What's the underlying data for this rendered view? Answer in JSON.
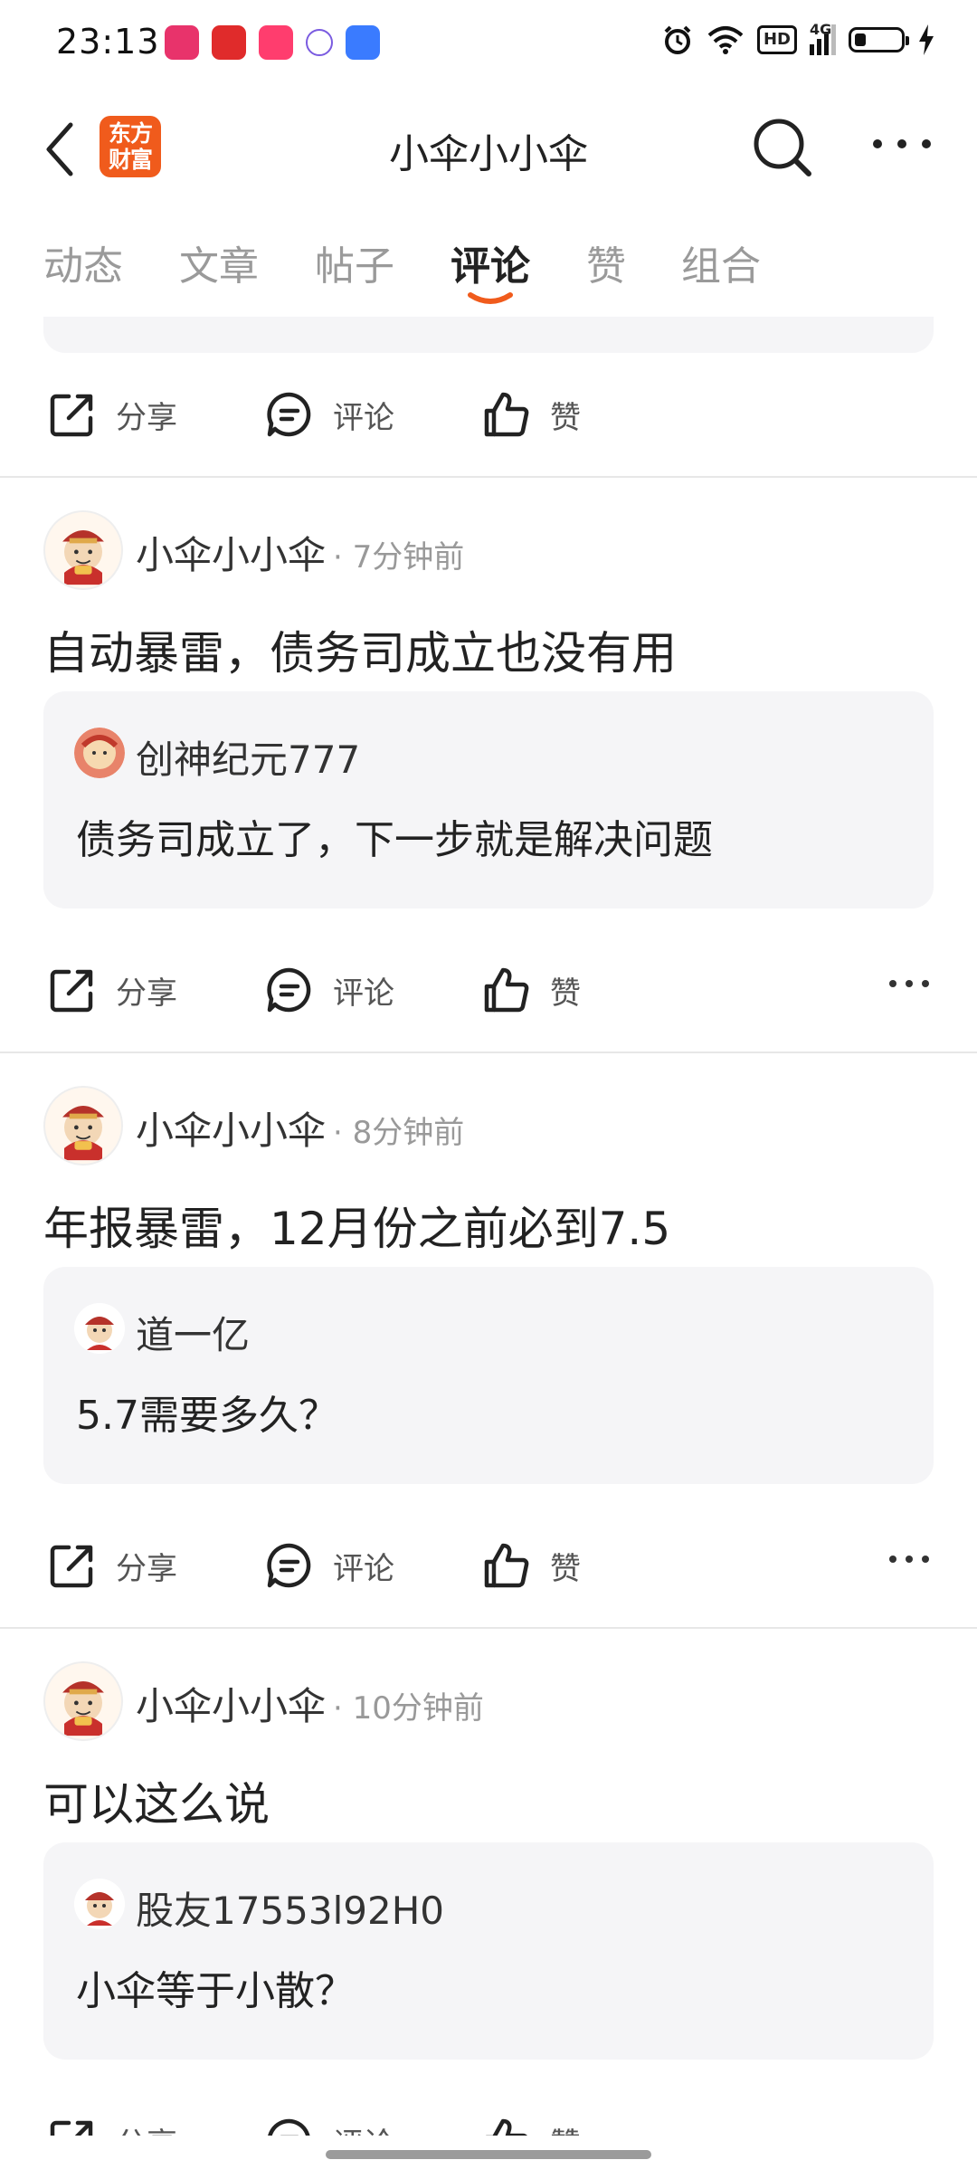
{
  "status_bar": {
    "time": "23:13",
    "signal_label": "4G",
    "hd_label": "HD"
  },
  "header": {
    "logo_text_line1": "东方",
    "logo_text_line2": "财富",
    "title": "小伞小小伞"
  },
  "tabs": [
    {
      "label": "动态"
    },
    {
      "label": "文章"
    },
    {
      "label": "帖子"
    },
    {
      "label": "评论",
      "active": true
    },
    {
      "label": "赞"
    },
    {
      "label": "组合"
    }
  ],
  "actions": {
    "share": "分享",
    "comment": "评论",
    "like": "赞"
  },
  "posts": [
    {
      "author": "小伞小小伞",
      "time": "· 7分钟前",
      "text": "自动暴雷，债务司成立也没有用",
      "quote": {
        "author": "创神纪元777",
        "text": "债务司成立了，下一步就是解决问题"
      }
    },
    {
      "author": "小伞小小伞",
      "time": "· 8分钟前",
      "text": "年报暴雷，12月份之前必到7.5",
      "quote": {
        "author": "道一亿",
        "text": "5.7需要多久？"
      }
    },
    {
      "author": "小伞小小伞",
      "time": "· 10分钟前",
      "text": "可以这么说",
      "quote": {
        "author": "股友17553l92H0",
        "text": "小伞等于小散？"
      }
    }
  ],
  "colors": {
    "brand": "#f05b1c",
    "card_bg": "#f5f5f7",
    "muted": "#999999"
  }
}
